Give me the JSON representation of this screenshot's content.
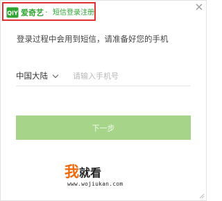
{
  "header": {
    "brand": "爱奇艺",
    "separator": "·",
    "title": "短信登录注册",
    "logo_text": "QIY"
  },
  "instruction": "登录过程中会用到短信，请准备好您的手机",
  "form": {
    "country": "中国大陆",
    "phone_placeholder": "请输入手机号",
    "phone_value": ""
  },
  "next_button_label": "下一步",
  "watermark": {
    "brand_first": "我",
    "brand_rest": "就看",
    "url": "www.wojiukan.com"
  },
  "colors": {
    "brand_green": "#2fa432",
    "button_green": "#a6d58a",
    "highlight_red": "#e23030",
    "watermark_orange": "#f06a0c"
  },
  "icons": [
    "iqiyi-logo-icon",
    "close-icon",
    "chevron-down-icon",
    "resize-icon"
  ]
}
